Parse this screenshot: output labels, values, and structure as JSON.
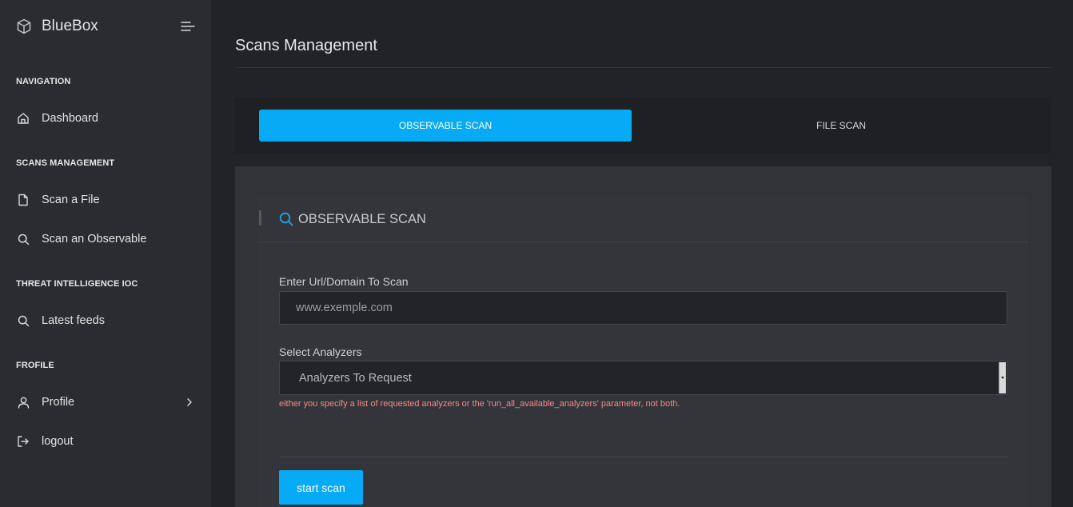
{
  "brand": {
    "name": "BlueBox",
    "logo_icon": "cube-icon"
  },
  "sidebar": {
    "sections": [
      {
        "title": "NAVIGATION"
      },
      {
        "title": "SCANS MANAGEMENT"
      },
      {
        "title": "THREAT INTELLIGENCE IOC"
      },
      {
        "title": "FROFILE"
      }
    ],
    "items": [
      {
        "label": "Dashboard",
        "icon": "home-icon"
      },
      {
        "label": "Scan a File",
        "icon": "file-icon"
      },
      {
        "label": "Scan an Observable",
        "icon": "search-icon"
      },
      {
        "label": "Latest feeds",
        "icon": "search-icon"
      },
      {
        "label": "Profile",
        "icon": "user-icon"
      },
      {
        "label": "logout",
        "icon": "logout-icon"
      }
    ]
  },
  "page": {
    "title": "Scans Management"
  },
  "tabs": [
    {
      "label": "OBSERVABLE SCAN",
      "active": true
    },
    {
      "label": "FILE SCAN",
      "active": false
    }
  ],
  "card": {
    "title": "OBSERVABLE SCAN",
    "icon": "search-icon"
  },
  "form": {
    "url_label": "Enter Url/Domain To Scan",
    "url_placeholder": "www.exemple.com",
    "analyzers_label": "Select Analyzers",
    "analyzers_value": "Analyzers To Request",
    "error": "either you specify a list of requested analyzers or the 'run_all_available_analyzers' parameter, not both.",
    "submit_label": "start scan"
  },
  "colors": {
    "accent": "#06aaf5",
    "sidebar_bg": "#2b2c31",
    "page_bg": "#222326",
    "error": "#f08a8a"
  }
}
